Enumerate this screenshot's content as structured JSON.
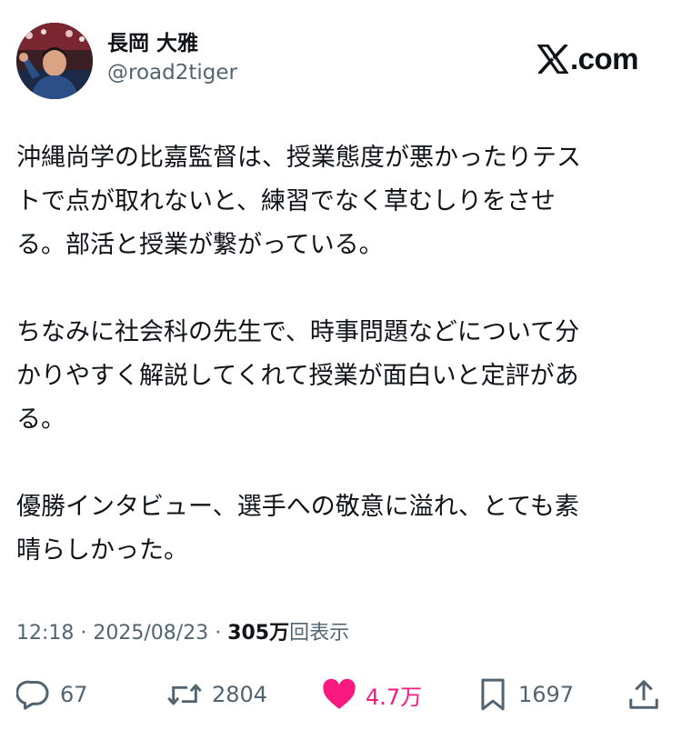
{
  "author": {
    "display_name": "長岡 大雅",
    "handle": "@road2tiger"
  },
  "brand": {
    "text": ".com",
    "icon": "x-logo-icon"
  },
  "tweet": {
    "paragraphs": [
      "沖縄尚学の比嘉監督は、授業態度が悪かったりテス\nトで点が取れないと、練習でなく草むしりをさせ\nる。部活と授業が繋がっている。",
      "ちなみに社会科の先生で、時事問題などについて分\nかりやすく解説してくれて授業が面白いと定評があ\nる。",
      "優勝インタビュー、選手への敬意に溢れ、とても素\n晴らしかった。"
    ]
  },
  "meta": {
    "time": "12:18",
    "separator": " · ",
    "date": "2025/08/23",
    "views_count": "305万",
    "views_label": "回表示"
  },
  "actions": {
    "reply": {
      "count": "67",
      "icon": "reply-icon"
    },
    "retweet": {
      "count": "2804",
      "icon": "retweet-icon"
    },
    "like": {
      "count": "4.7万",
      "icon": "heart-icon",
      "color": "#f91880"
    },
    "bookmark": {
      "count": "1697",
      "icon": "bookmark-icon"
    },
    "share": {
      "icon": "share-icon"
    }
  }
}
